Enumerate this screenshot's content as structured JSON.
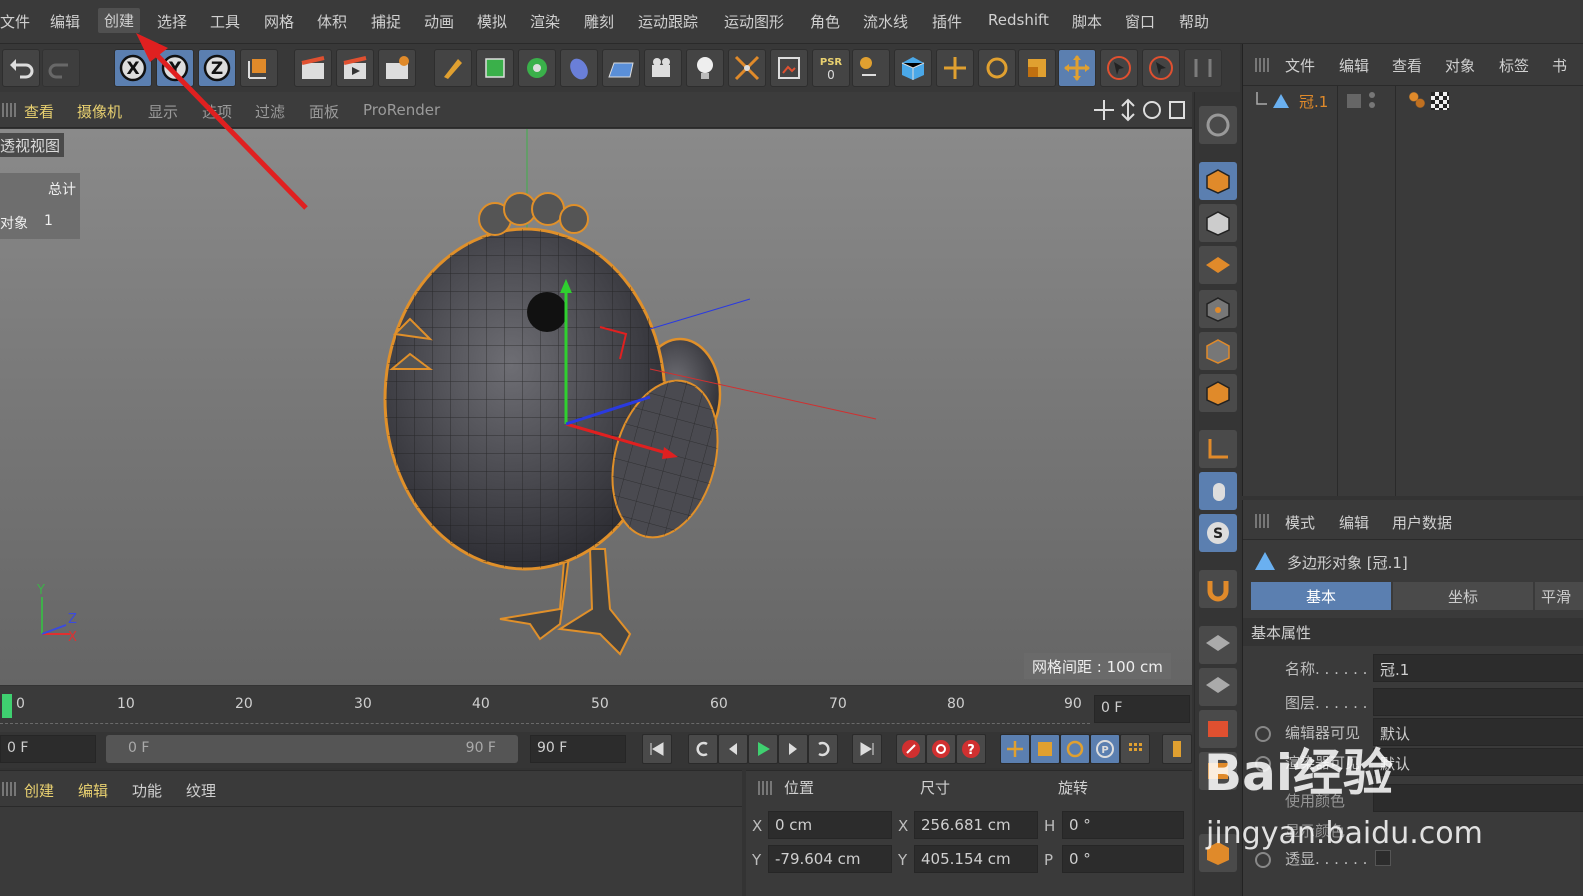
{
  "menubar": {
    "items": [
      "文件",
      "编辑",
      "创建",
      "选择",
      "工具",
      "网格",
      "体积",
      "捕捉",
      "动画",
      "模拟",
      "渲染",
      "雕刻",
      "运动跟踪",
      "运动图形",
      "角色",
      "流水线",
      "插件",
      "Redshift",
      "脚本",
      "窗口",
      "帮助"
    ],
    "active": "创建"
  },
  "toolbar": {
    "axis_x": "X",
    "axis_y": "Y",
    "axis_z": "Z",
    "psr_label": "PSR",
    "psr_value": "0"
  },
  "viewport": {
    "menus": [
      "查看",
      "摄像机",
      "显示",
      "选项",
      "过滤",
      "面板",
      "ProRender"
    ],
    "view_name": "透视视图",
    "stats_header": "总计",
    "stats_label": "对象",
    "stats_value": "1",
    "grid_spacing": "网格间距 : 100 cm",
    "axis_y": "Y",
    "axis_z": "Z",
    "axis_x": "X"
  },
  "object_manager": {
    "menus": [
      "文件",
      "编辑",
      "查看",
      "对象",
      "标签",
      "书"
    ],
    "object_name": "冠.1"
  },
  "attributes": {
    "menus": [
      "模式",
      "编辑",
      "用户数据"
    ],
    "object_title": "多边形对象 [冠.1]",
    "tabs": [
      "基本",
      "坐标",
      "平滑"
    ],
    "active_tab": "基本",
    "section": "基本属性",
    "rows": [
      {
        "label": "名称. . . . . .",
        "value": "冠.1"
      },
      {
        "label": "图层. . . . . .",
        "value": ""
      },
      {
        "label": "编辑器可见",
        "value": "默认"
      },
      {
        "label": "渲染器可见",
        "value": "默认"
      },
      {
        "label": "使用颜色",
        "value": ""
      },
      {
        "label": "显示颜色",
        "value": ""
      },
      {
        "label": "透显. . . . . .",
        "value": ""
      }
    ]
  },
  "timeline": {
    "ticks": [
      "0",
      "10",
      "20",
      "30",
      "40",
      "50",
      "60",
      "70",
      "80",
      "90"
    ],
    "current_frame": "0 F"
  },
  "transport": {
    "start_field": "0 F",
    "range_start": "0 F",
    "range_end": "90 F",
    "end_field": "90 F"
  },
  "material_manager": {
    "menus": [
      "创建",
      "编辑",
      "功能",
      "纹理"
    ]
  },
  "coordinates": {
    "headers": [
      "位置",
      "尺寸",
      "旋转"
    ],
    "rows": [
      {
        "axis": "X",
        "pos": "0 cm",
        "size_axis": "X",
        "size": "256.681 cm",
        "rot_axis": "H",
        "rot": "0 °"
      },
      {
        "axis": "Y",
        "pos": "-79.604 cm",
        "size_axis": "Y",
        "size": "405.154 cm",
        "rot_axis": "P",
        "rot": "0 °"
      }
    ]
  },
  "watermark": {
    "brand": "Bai经验",
    "url": "jingyan.baidu.com"
  },
  "colors": {
    "accent": "#e8d070",
    "selection_orange": "#e0902a",
    "tab_active": "#5b7fb0",
    "annotation_arrow": "#e02020"
  }
}
